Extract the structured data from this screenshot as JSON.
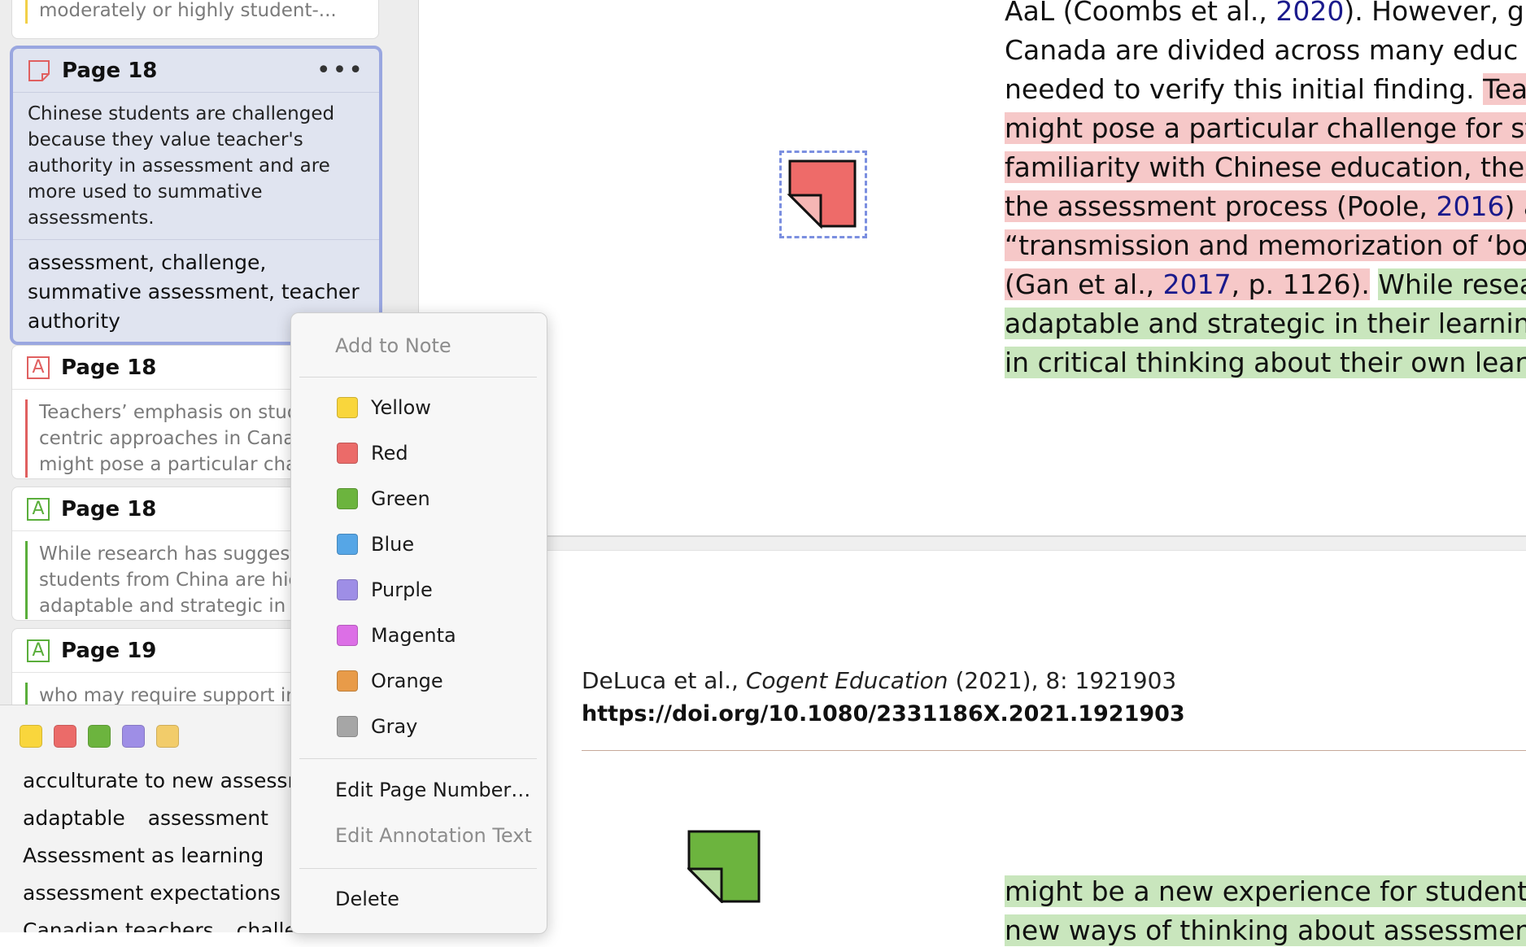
{
  "sidebar": {
    "top_card": {
      "body": "moderately or highly student-..."
    },
    "selected_card": {
      "title": "Page 18",
      "more": "•••",
      "comment": "Chinese students are challenged because they value teacher's authority in assessment and are more used to summative assessments.",
      "tags": "assessment, challenge, summative assessment, teacher authority"
    },
    "cards": [
      {
        "title": "Page 18",
        "type": "highlight",
        "color": "#e06060",
        "lines": [
          "Teachers’ emphasis on stud",
          "centric approaches in Cana",
          "might pose a particular cha"
        ]
      },
      {
        "title": "Page 18",
        "type": "highlight",
        "color": "#5aae3b",
        "lines": [
          "While research has suggest",
          "students from China are hig",
          "adaptable and strategic in t"
        ]
      },
      {
        "title": "Page 19",
        "type": "highlight",
        "color": "#5aae3b",
        "lines": [
          "who may require support in"
        ]
      }
    ],
    "icon_letter": "A",
    "tag_panel": {
      "swatch_colors": [
        "#f9d63c",
        "#eb6b69",
        "#6cb43e",
        "#9e8ee6",
        "#f2cc6a"
      ],
      "tags": [
        [
          "acculturate to new assessm"
        ],
        [
          "adaptable",
          "assessment"
        ],
        [
          "Assessment as learning"
        ],
        [
          "assessment expectations"
        ],
        [
          "Canadian teachers",
          "challen"
        ]
      ]
    }
  },
  "document": {
    "lines_top": [
      [
        "AaL (Coombs et al., ",
        "2020",
        "). However, give"
      ],
      [
        "Canada are divided across many educ"
      ],
      [
        "needed to verify this initial finding. ",
        "Teach"
      ],
      [
        "might pose a particular challenge for stu"
      ],
      [
        "familiarity with Chinese education, these"
      ],
      [
        "the assessment process (Poole, ",
        "2016",
        ") an"
      ],
      [
        "“transmission and memorization of ‘book"
      ],
      [
        "(Gan et al., ",
        "2017",
        ", p. 1126).",
        " ",
        "While resea"
      ],
      [
        "adaptable and strategic in their learning ("
      ],
      [
        "in critical thinking about their own learnin"
      ]
    ],
    "citation_prefix": "DeLuca et al., ",
    "citation_journal": "Cogent Education",
    "citation_suffix": " (2021), 8: 1921903",
    "doi": "https://doi.org/10.1080/2331186X.2021.1921903",
    "lines_bottom": [
      "might be a new experience for students",
      "new ways of thinking about assessment’s"
    ]
  },
  "context_menu": {
    "add_to_note": "Add to Note",
    "colors": [
      {
        "label": "Yellow",
        "hex": "#f9d63c"
      },
      {
        "label": "Red",
        "hex": "#eb6b69"
      },
      {
        "label": "Green",
        "hex": "#6cb43e"
      },
      {
        "label": "Blue",
        "hex": "#56a6e6"
      },
      {
        "label": "Purple",
        "hex": "#9e8ee6"
      },
      {
        "label": "Magenta",
        "hex": "#dc6fe6"
      },
      {
        "label": "Orange",
        "hex": "#e89b49"
      },
      {
        "label": "Gray",
        "hex": "#a6a6a6"
      }
    ],
    "edit_page_number": "Edit Page Number…",
    "edit_annotation_text": "Edit Annotation Text",
    "delete": "Delete"
  }
}
